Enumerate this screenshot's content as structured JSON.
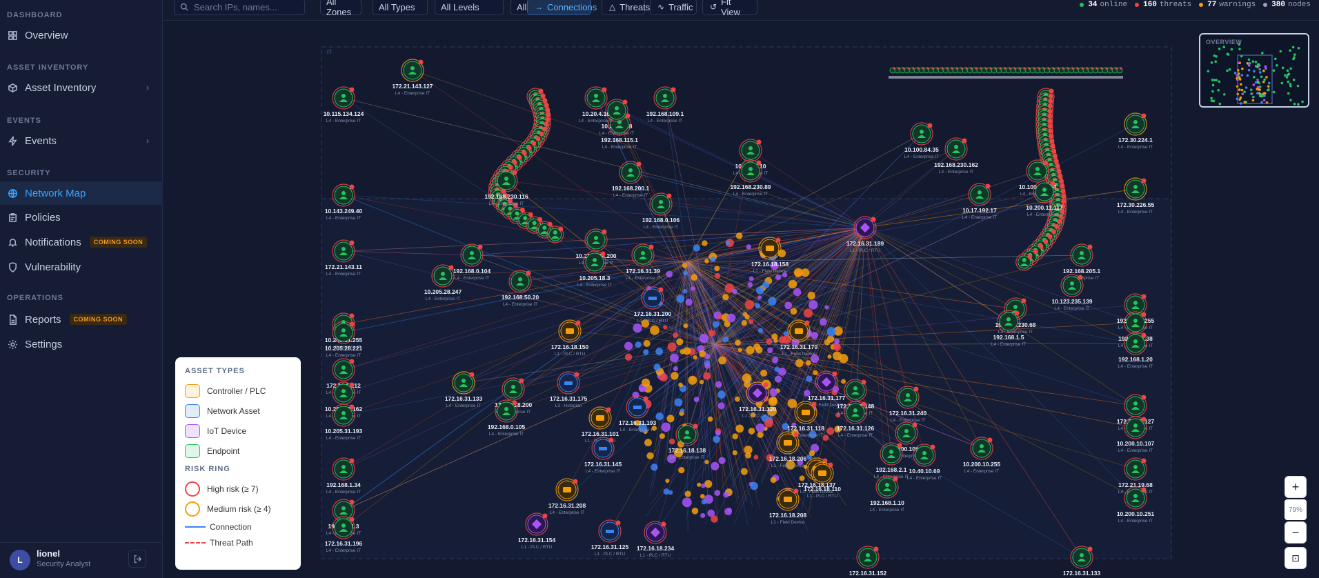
{
  "sidebar": {
    "sections": [
      {
        "title": "DASHBOARD",
        "items": [
          {
            "label": "Overview",
            "icon": "grid-icon",
            "chevron": false,
            "active": false
          }
        ]
      },
      {
        "title": "ASSET INVENTORY",
        "items": [
          {
            "label": "Asset Inventory",
            "icon": "box-icon",
            "chevron": true,
            "active": false
          }
        ]
      },
      {
        "title": "EVENTS",
        "items": [
          {
            "label": "Events",
            "icon": "bolt-icon",
            "chevron": true,
            "active": false
          }
        ]
      },
      {
        "title": "SECURITY",
        "items": [
          {
            "label": "Network Map",
            "icon": "globe-icon",
            "chevron": false,
            "active": true
          },
          {
            "label": "Policies",
            "icon": "clipboard-icon",
            "chevron": false,
            "active": false
          },
          {
            "label": "Notifications",
            "icon": "bell-icon",
            "chevron": false,
            "active": false,
            "badge": "COMING SOON"
          },
          {
            "label": "Vulnerability",
            "icon": "shield-icon",
            "chevron": false,
            "active": false
          }
        ]
      },
      {
        "title": "OPERATIONS",
        "items": [
          {
            "label": "Reports",
            "icon": "file-icon",
            "chevron": false,
            "active": false,
            "badge": "COMING SOON"
          },
          {
            "label": "Settings",
            "icon": "gear-icon",
            "chevron": false,
            "active": false
          }
        ]
      }
    ],
    "user": {
      "initial": "L",
      "name": "lionel",
      "role": "Security Analyst"
    }
  },
  "toolbar": {
    "search_placeholder": "Search IPs, names...",
    "filters": [
      "All Zones",
      "All Types",
      "All Levels",
      "All Protocols"
    ],
    "buttons": [
      {
        "label": "Connections",
        "glyph": "→",
        "active": true
      },
      {
        "label": "Threats",
        "glyph": "△",
        "active": false
      },
      {
        "label": "Traffic",
        "glyph": "∿",
        "active": false
      },
      {
        "label": "Fit View",
        "glyph": "↺",
        "active": false
      }
    ],
    "stats": [
      {
        "value": "34",
        "label": "online",
        "color": "#22c55e"
      },
      {
        "value": "160",
        "label": "threats",
        "color": "#ef4444"
      },
      {
        "value": "77",
        "label": "warnings",
        "color": "#f59e0b"
      },
      {
        "value": "380",
        "label": "nodes",
        "color": "#94a3b8"
      }
    ]
  },
  "map": {
    "zone_label": "IT",
    "nodes": [
      {
        "ip": "10.115.134.124",
        "zone": "L4 - Enterprise IT",
        "kind": "endpoint",
        "risk": "high"
      },
      {
        "ip": "10.143.249.40",
        "zone": "L4 - Enterprise IT",
        "kind": "endpoint",
        "risk": "high"
      },
      {
        "ip": "172.21.143.11",
        "zone": "L4 - Enterprise IT",
        "kind": "endpoint",
        "risk": "high"
      },
      {
        "ip": "10.205.31.255",
        "zone": "L4 - Enterprise IT",
        "kind": "endpoint",
        "risk": "high"
      },
      {
        "ip": "10.205.28.221",
        "zone": "L4 - Enterprise IT",
        "kind": "endpoint",
        "risk": "high"
      },
      {
        "ip": "172.16.1.212",
        "zone": "L4 - Enterprise IT",
        "kind": "endpoint",
        "risk": "high"
      },
      {
        "ip": "10.205.30.162",
        "zone": "L4 - Enterprise IT",
        "kind": "endpoint",
        "risk": "high"
      },
      {
        "ip": "10.205.31.193",
        "zone": "L4 - Enterprise IT",
        "kind": "endpoint",
        "risk": "high"
      },
      {
        "ip": "192.168.1.34",
        "zone": "L4 - Enterprise IT",
        "kind": "endpoint",
        "risk": "high"
      },
      {
        "ip": "192.168.1.3",
        "zone": "L4 - Enterprise IT",
        "kind": "endpoint",
        "risk": "high"
      },
      {
        "ip": "172.16.31.196",
        "zone": "L4 - Enterprise IT",
        "kind": "endpoint",
        "risk": "high"
      },
      {
        "ip": "172.21.143.127",
        "zone": "L4 - Enterprise IT",
        "kind": "endpoint",
        "risk": "medium"
      },
      {
        "ip": "10.212.134.200",
        "zone": "L4 - Enterprise IT",
        "kind": "endpoint",
        "risk": "high"
      },
      {
        "ip": "10.205.18.3",
        "zone": "L4 - Enterprise IT",
        "kind": "endpoint",
        "risk": "high"
      },
      {
        "ip": "172.16.31.39",
        "zone": "L4 - Enterprise IT",
        "kind": "endpoint",
        "risk": "high"
      },
      {
        "ip": "192.168.0.106",
        "zone": "L4 - Enterprise IT",
        "kind": "endpoint",
        "risk": "high"
      },
      {
        "ip": "192.168.50.20",
        "zone": "L4 - Enterprise IT",
        "kind": "endpoint",
        "risk": "high"
      },
      {
        "ip": "10.205.28.247",
        "zone": "L4 - Enterprise IT",
        "kind": "endpoint",
        "risk": "high"
      },
      {
        "ip": "192.168.0.104",
        "zone": "L4 - Enterprise IT",
        "kind": "endpoint",
        "risk": "high"
      },
      {
        "ip": "172.16.31.189",
        "zone": "L1 - PLC / RTU",
        "kind": "iot",
        "risk": "high"
      },
      {
        "ip": "172.16.18.158",
        "zone": "L1 - Field Device",
        "kind": "controller",
        "risk": "medium"
      },
      {
        "ip": "172.16.18.150",
        "zone": "L1 - PLC / RTU",
        "kind": "controller",
        "risk": "medium"
      },
      {
        "ip": "172.16.31.175",
        "zone": "L3 - Historian",
        "kind": "network",
        "risk": "high"
      },
      {
        "ip": "172.16.31.133",
        "zone": "L4 - Enterprise IT",
        "kind": "endpoint",
        "risk": "medium"
      },
      {
        "ip": "172.16.18.200",
        "zone": "L4 - Enterprise IT",
        "kind": "endpoint",
        "risk": "high"
      },
      {
        "ip": "192.168.0.105",
        "zone": "L4 - Enterprise IT",
        "kind": "endpoint",
        "risk": "high"
      },
      {
        "ip": "172.16.31.148",
        "zone": "L4 - Enterprise IT",
        "kind": "endpoint",
        "risk": "high"
      },
      {
        "ip": "172.16.31.126",
        "zone": "L4 - Enterprise IT",
        "kind": "endpoint",
        "risk": "high"
      },
      {
        "ip": "172.16.31.240",
        "zone": "L4 - Enterprise IT",
        "kind": "endpoint",
        "risk": "high"
      },
      {
        "ip": "10.200.105.1",
        "zone": "L4 - Enterprise IT",
        "kind": "endpoint",
        "risk": "high"
      },
      {
        "ip": "192.168.2.1",
        "zone": "L4 - Enterprise IT",
        "kind": "endpoint",
        "risk": "high"
      },
      {
        "ip": "10.40.10.69",
        "zone": "L4 - Enterprise IT",
        "kind": "endpoint",
        "risk": "high"
      },
      {
        "ip": "192.168.1.10",
        "zone": "L4 - Enterprise IT",
        "kind": "endpoint",
        "risk": "high"
      },
      {
        "ip": "10.200.10.255",
        "zone": "L4 - Enterprise IT",
        "kind": "endpoint",
        "risk": "high"
      },
      {
        "ip": "172.30.224.1",
        "zone": "L4 - Enterprise IT",
        "kind": "endpoint",
        "risk": "medium"
      },
      {
        "ip": "172.30.226.55",
        "zone": "L4 - Enterprise IT",
        "kind": "endpoint",
        "risk": "medium"
      },
      {
        "ip": "192.168.1.255",
        "zone": "L4 - Enterprise IT",
        "kind": "endpoint",
        "risk": "high"
      },
      {
        "ip": "192.168.1.38",
        "zone": "L4 - Enterprise IT",
        "kind": "endpoint",
        "risk": "high"
      },
      {
        "ip": "192.168.1.20",
        "zone": "L4 - Enterprise IT",
        "kind": "endpoint",
        "risk": "high"
      },
      {
        "ip": "172.21.19.127",
        "zone": "L4 - Enterprise IT",
        "kind": "endpoint",
        "risk": "high"
      },
      {
        "ip": "10.200.10.107",
        "zone": "L4 - Enterprise IT",
        "kind": "endpoint",
        "risk": "high"
      },
      {
        "ip": "172.21.19.68",
        "zone": "L4 - Enterprise IT",
        "kind": "endpoint",
        "risk": "high"
      },
      {
        "ip": "10.200.10.251",
        "zone": "L4 - Enterprise IT",
        "kind": "endpoint",
        "risk": "high"
      },
      {
        "ip": "172.16.31.133",
        "zone": "L4 - Enterprise IT",
        "kind": "endpoint",
        "risk": "high"
      },
      {
        "ip": "172.16.31.152",
        "zone": "L4 - Enterprise IT",
        "kind": "endpoint",
        "risk": "high"
      },
      {
        "ip": "192.168.230.116",
        "zone": "L4 - Enterprise IT",
        "kind": "endpoint",
        "risk": "high"
      },
      {
        "ip": "192.168.200.1",
        "zone": "L4 - Enterprise IT",
        "kind": "endpoint",
        "risk": "high"
      },
      {
        "ip": "192.168.115.1",
        "zone": "L4 - Enterprise IT",
        "kind": "endpoint",
        "risk": "high"
      },
      {
        "ip": "10.176.1.10",
        "zone": "L4 - Enterprise IT",
        "kind": "endpoint",
        "risk": "high"
      },
      {
        "ip": "192.168.230.89",
        "zone": "L4 - Enterprise IT",
        "kind": "endpoint",
        "risk": "high"
      },
      {
        "ip": "10.20.4.10",
        "zone": "L4 - Enterprise IT",
        "kind": "endpoint",
        "risk": "high"
      },
      {
        "ip": "10.200.8.18",
        "zone": "L4 - Enterprise IT",
        "kind": "endpoint",
        "risk": "high"
      },
      {
        "ip": "192.168.109.1",
        "zone": "L4 - Enterprise IT",
        "kind": "endpoint",
        "risk": "high"
      },
      {
        "ip": "10.100.18.244",
        "zone": "L4 - Enterprise IT",
        "kind": "endpoint",
        "risk": "high"
      },
      {
        "ip": "10.200.11.117",
        "zone": "L4 - Enterprise IT",
        "kind": "endpoint",
        "risk": "high"
      },
      {
        "ip": "192.168.205.1",
        "zone": "L4 - Enterprise IT",
        "kind": "endpoint",
        "risk": "high"
      },
      {
        "ip": "10.123.235.139",
        "zone": "L4 - Enterprise IT",
        "kind": "endpoint",
        "risk": "high"
      },
      {
        "ip": "192.168.230.68",
        "zone": "L4 - Enterprise IT",
        "kind": "endpoint",
        "risk": "high"
      },
      {
        "ip": "192.168.1.5",
        "zone": "L4 - Enterprise IT",
        "kind": "endpoint",
        "risk": "high"
      },
      {
        "ip": "10.17.192.17",
        "zone": "L4 - Enterprise IT",
        "kind": "endpoint",
        "risk": "high"
      },
      {
        "ip": "10.100.84.35",
        "zone": "L4 - Enterprise IT",
        "kind": "endpoint",
        "risk": "high"
      },
      {
        "ip": "192.168.230.162",
        "zone": "L4 - Enterprise IT",
        "kind": "endpoint",
        "risk": "high"
      },
      {
        "ip": "172.16.31.101",
        "zone": "L1 - PLC / RTU",
        "kind": "controller",
        "risk": "medium"
      },
      {
        "ip": "172.16.31.145",
        "zone": "L4 - Enterprise IT",
        "kind": "network",
        "risk": "high"
      },
      {
        "ip": "172.16.31.208",
        "zone": "L4 - Enterprise IT",
        "kind": "controller",
        "risk": "medium"
      },
      {
        "ip": "172.16.18.137",
        "zone": "L1 - Field Device",
        "kind": "controller",
        "risk": "medium"
      },
      {
        "ip": "172.16.31.118",
        "zone": "L4 - Enterprise IT",
        "kind": "controller",
        "risk": "medium"
      },
      {
        "ip": "172.16.18.208",
        "zone": "L1 - Field Device",
        "kind": "controller",
        "risk": "medium"
      },
      {
        "ip": "172.16.31.125",
        "zone": "L1 - PLC / RTU",
        "kind": "network",
        "risk": "high"
      },
      {
        "ip": "172.16.18.234",
        "zone": "L1 - PLC / RTU",
        "kind": "iot",
        "risk": "high"
      },
      {
        "ip": "172.16.31.154",
        "zone": "L1 - PLC / RTU",
        "kind": "iot",
        "risk": "high"
      },
      {
        "ip": "172.16.18.138",
        "zone": "L4 - Enterprise IT",
        "kind": "endpoint",
        "risk": "high"
      },
      {
        "ip": "172.16.31.193",
        "zone": "L4 - Enterprise IT",
        "kind": "network",
        "risk": "high"
      },
      {
        "ip": "172.16.31.177",
        "zone": "L1 - Field Device",
        "kind": "iot",
        "risk": "high"
      },
      {
        "ip": "172.16.31.170",
        "zone": "L1 - Field Device",
        "kind": "controller",
        "risk": "medium"
      },
      {
        "ip": "172.16.31.200",
        "zone": "L1 - PLC / RTU",
        "kind": "network",
        "risk": "high"
      },
      {
        "ip": "172.16.31.120",
        "zone": "L1 - PLC / RTU",
        "kind": "iot",
        "risk": "medium"
      },
      {
        "ip": "172.16.18.110",
        "zone": "L1 - PLC / RTU",
        "kind": "controller",
        "risk": "medium"
      },
      {
        "ip": "172.16.18.206",
        "zone": "L1 - Field Device",
        "kind": "controller",
        "risk": "medium"
      }
    ]
  },
  "overview_label": "OVERVIEW",
  "legend": {
    "asset_title": "ASSET TYPES",
    "assets": [
      {
        "label": "Controller / PLC",
        "bg": "#fdf2dc",
        "border": "#f59e0b"
      },
      {
        "label": "Network Asset",
        "bg": "#e2ecfb",
        "border": "#3b82f6"
      },
      {
        "label": "IoT Device",
        "bg": "#efe3fb",
        "border": "#a855f7"
      },
      {
        "label": "Endpoint",
        "bg": "#dff7ea",
        "border": "#22c55e"
      }
    ],
    "risk_title": "RISK RING",
    "risks": [
      {
        "label": "High risk (≥ 7)",
        "color": "#ef4444"
      },
      {
        "label": "Medium risk (≥ 4)",
        "color": "#f59e0b"
      }
    ],
    "lines": [
      {
        "label": "Connection",
        "color": "#3b82f6",
        "dashed": false
      },
      {
        "label": "Threat Path",
        "color": "#ef4444",
        "dashed": true
      }
    ]
  },
  "zoom": {
    "in": "+",
    "level": "79%",
    "out": "−",
    "fit": "⊡"
  }
}
